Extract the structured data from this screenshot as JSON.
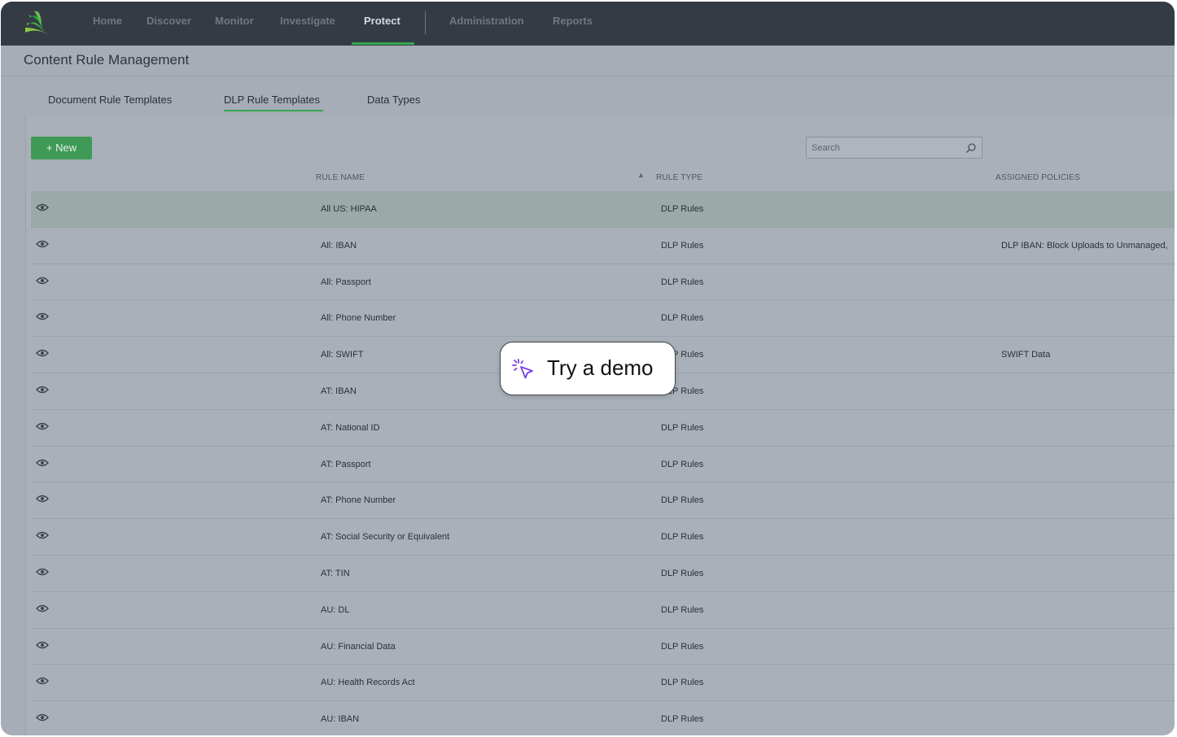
{
  "nav": {
    "items": [
      {
        "label": "Home"
      },
      {
        "label": "Discover"
      },
      {
        "label": "Monitor"
      },
      {
        "label": "Investigate"
      },
      {
        "label": "Protect",
        "active": true
      },
      {
        "label": "Administration"
      },
      {
        "label": "Reports"
      }
    ],
    "logo_icon": "leaf-logo-icon"
  },
  "page": {
    "title": "Content Rule Management"
  },
  "tabs": [
    {
      "label": "Document Rule Templates"
    },
    {
      "label": "DLP Rule Templates",
      "active": true
    },
    {
      "label": "Data Types"
    }
  ],
  "toolbar": {
    "new_label": "+ New",
    "search_placeholder": "Search"
  },
  "table": {
    "columns": {
      "name": "RULE NAME",
      "type": "RULE TYPE",
      "policies": "ASSIGNED POLICIES"
    },
    "sorted_column": "RULE NAME",
    "rows": [
      {
        "name": "All US: HIPAA",
        "type": "DLP Rules",
        "policies": "",
        "selected": true
      },
      {
        "name": "All: IBAN",
        "type": "DLP Rules",
        "policies": "DLP IBAN: Block Uploads to Unmanaged,"
      },
      {
        "name": "All: Passport",
        "type": "DLP Rules",
        "policies": ""
      },
      {
        "name": "All: Phone Number",
        "type": "DLP Rules",
        "policies": ""
      },
      {
        "name": "All: SWIFT",
        "type": "DLP Rules",
        "policies": "SWIFT Data"
      },
      {
        "name": "AT: IBAN",
        "type": "DLP Rules",
        "policies": ""
      },
      {
        "name": "AT: National ID",
        "type": "DLP Rules",
        "policies": ""
      },
      {
        "name": "AT: Passport",
        "type": "DLP Rules",
        "policies": ""
      },
      {
        "name": "AT: Phone Number",
        "type": "DLP Rules",
        "policies": ""
      },
      {
        "name": "AT: Social Security or Equivalent",
        "type": "DLP Rules",
        "policies": ""
      },
      {
        "name": "AT: TIN",
        "type": "DLP Rules",
        "policies": ""
      },
      {
        "name": "AU: DL",
        "type": "DLP Rules",
        "policies": ""
      },
      {
        "name": "AU: Financial Data",
        "type": "DLP Rules",
        "policies": ""
      },
      {
        "name": "AU: Health Records Act",
        "type": "DLP Rules",
        "policies": ""
      },
      {
        "name": "AU: IBAN",
        "type": "DLP Rules",
        "policies": ""
      }
    ]
  },
  "overlay": {
    "label": "Try a demo",
    "icon": "cursor-sparkle-icon"
  },
  "colors": {
    "nav_bg": "#343b44",
    "accent_green": "#35a650",
    "new_button": "#3f9a57",
    "demo_icon": "#7b3fe4"
  }
}
